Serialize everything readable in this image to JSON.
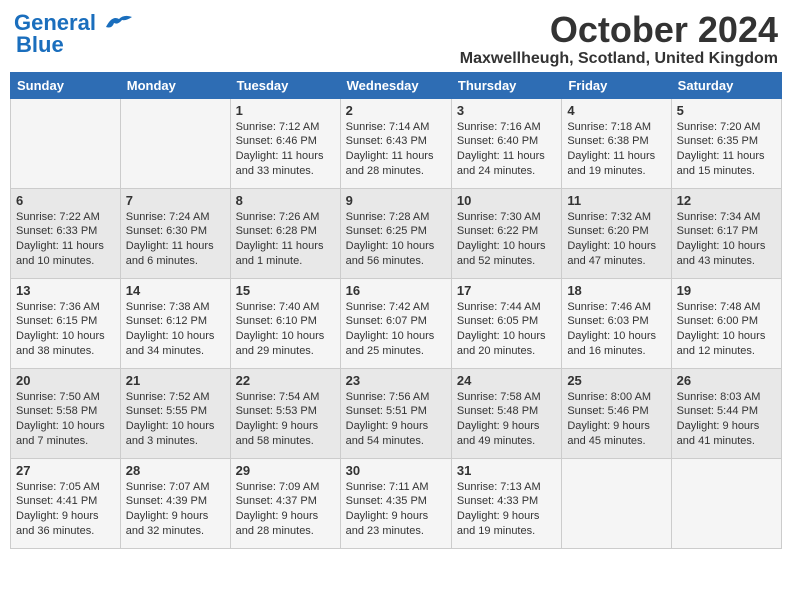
{
  "header": {
    "logo_line1": "General",
    "logo_line2": "Blue",
    "month_title": "October 2024",
    "location": "Maxwellheugh, Scotland, United Kingdom"
  },
  "days_of_week": [
    "Sunday",
    "Monday",
    "Tuesday",
    "Wednesday",
    "Thursday",
    "Friday",
    "Saturday"
  ],
  "weeks": [
    [
      {
        "day": "",
        "info": ""
      },
      {
        "day": "",
        "info": ""
      },
      {
        "day": "1",
        "info": "Sunrise: 7:12 AM\nSunset: 6:46 PM\nDaylight: 11 hours and 33 minutes."
      },
      {
        "day": "2",
        "info": "Sunrise: 7:14 AM\nSunset: 6:43 PM\nDaylight: 11 hours and 28 minutes."
      },
      {
        "day": "3",
        "info": "Sunrise: 7:16 AM\nSunset: 6:40 PM\nDaylight: 11 hours and 24 minutes."
      },
      {
        "day": "4",
        "info": "Sunrise: 7:18 AM\nSunset: 6:38 PM\nDaylight: 11 hours and 19 minutes."
      },
      {
        "day": "5",
        "info": "Sunrise: 7:20 AM\nSunset: 6:35 PM\nDaylight: 11 hours and 15 minutes."
      }
    ],
    [
      {
        "day": "6",
        "info": "Sunrise: 7:22 AM\nSunset: 6:33 PM\nDaylight: 11 hours and 10 minutes."
      },
      {
        "day": "7",
        "info": "Sunrise: 7:24 AM\nSunset: 6:30 PM\nDaylight: 11 hours and 6 minutes."
      },
      {
        "day": "8",
        "info": "Sunrise: 7:26 AM\nSunset: 6:28 PM\nDaylight: 11 hours and 1 minute."
      },
      {
        "day": "9",
        "info": "Sunrise: 7:28 AM\nSunset: 6:25 PM\nDaylight: 10 hours and 56 minutes."
      },
      {
        "day": "10",
        "info": "Sunrise: 7:30 AM\nSunset: 6:22 PM\nDaylight: 10 hours and 52 minutes."
      },
      {
        "day": "11",
        "info": "Sunrise: 7:32 AM\nSunset: 6:20 PM\nDaylight: 10 hours and 47 minutes."
      },
      {
        "day": "12",
        "info": "Sunrise: 7:34 AM\nSunset: 6:17 PM\nDaylight: 10 hours and 43 minutes."
      }
    ],
    [
      {
        "day": "13",
        "info": "Sunrise: 7:36 AM\nSunset: 6:15 PM\nDaylight: 10 hours and 38 minutes."
      },
      {
        "day": "14",
        "info": "Sunrise: 7:38 AM\nSunset: 6:12 PM\nDaylight: 10 hours and 34 minutes."
      },
      {
        "day": "15",
        "info": "Sunrise: 7:40 AM\nSunset: 6:10 PM\nDaylight: 10 hours and 29 minutes."
      },
      {
        "day": "16",
        "info": "Sunrise: 7:42 AM\nSunset: 6:07 PM\nDaylight: 10 hours and 25 minutes."
      },
      {
        "day": "17",
        "info": "Sunrise: 7:44 AM\nSunset: 6:05 PM\nDaylight: 10 hours and 20 minutes."
      },
      {
        "day": "18",
        "info": "Sunrise: 7:46 AM\nSunset: 6:03 PM\nDaylight: 10 hours and 16 minutes."
      },
      {
        "day": "19",
        "info": "Sunrise: 7:48 AM\nSunset: 6:00 PM\nDaylight: 10 hours and 12 minutes."
      }
    ],
    [
      {
        "day": "20",
        "info": "Sunrise: 7:50 AM\nSunset: 5:58 PM\nDaylight: 10 hours and 7 minutes."
      },
      {
        "day": "21",
        "info": "Sunrise: 7:52 AM\nSunset: 5:55 PM\nDaylight: 10 hours and 3 minutes."
      },
      {
        "day": "22",
        "info": "Sunrise: 7:54 AM\nSunset: 5:53 PM\nDaylight: 9 hours and 58 minutes."
      },
      {
        "day": "23",
        "info": "Sunrise: 7:56 AM\nSunset: 5:51 PM\nDaylight: 9 hours and 54 minutes."
      },
      {
        "day": "24",
        "info": "Sunrise: 7:58 AM\nSunset: 5:48 PM\nDaylight: 9 hours and 49 minutes."
      },
      {
        "day": "25",
        "info": "Sunrise: 8:00 AM\nSunset: 5:46 PM\nDaylight: 9 hours and 45 minutes."
      },
      {
        "day": "26",
        "info": "Sunrise: 8:03 AM\nSunset: 5:44 PM\nDaylight: 9 hours and 41 minutes."
      }
    ],
    [
      {
        "day": "27",
        "info": "Sunrise: 7:05 AM\nSunset: 4:41 PM\nDaylight: 9 hours and 36 minutes."
      },
      {
        "day": "28",
        "info": "Sunrise: 7:07 AM\nSunset: 4:39 PM\nDaylight: 9 hours and 32 minutes."
      },
      {
        "day": "29",
        "info": "Sunrise: 7:09 AM\nSunset: 4:37 PM\nDaylight: 9 hours and 28 minutes."
      },
      {
        "day": "30",
        "info": "Sunrise: 7:11 AM\nSunset: 4:35 PM\nDaylight: 9 hours and 23 minutes."
      },
      {
        "day": "31",
        "info": "Sunrise: 7:13 AM\nSunset: 4:33 PM\nDaylight: 9 hours and 19 minutes."
      },
      {
        "day": "",
        "info": ""
      },
      {
        "day": "",
        "info": ""
      }
    ]
  ]
}
